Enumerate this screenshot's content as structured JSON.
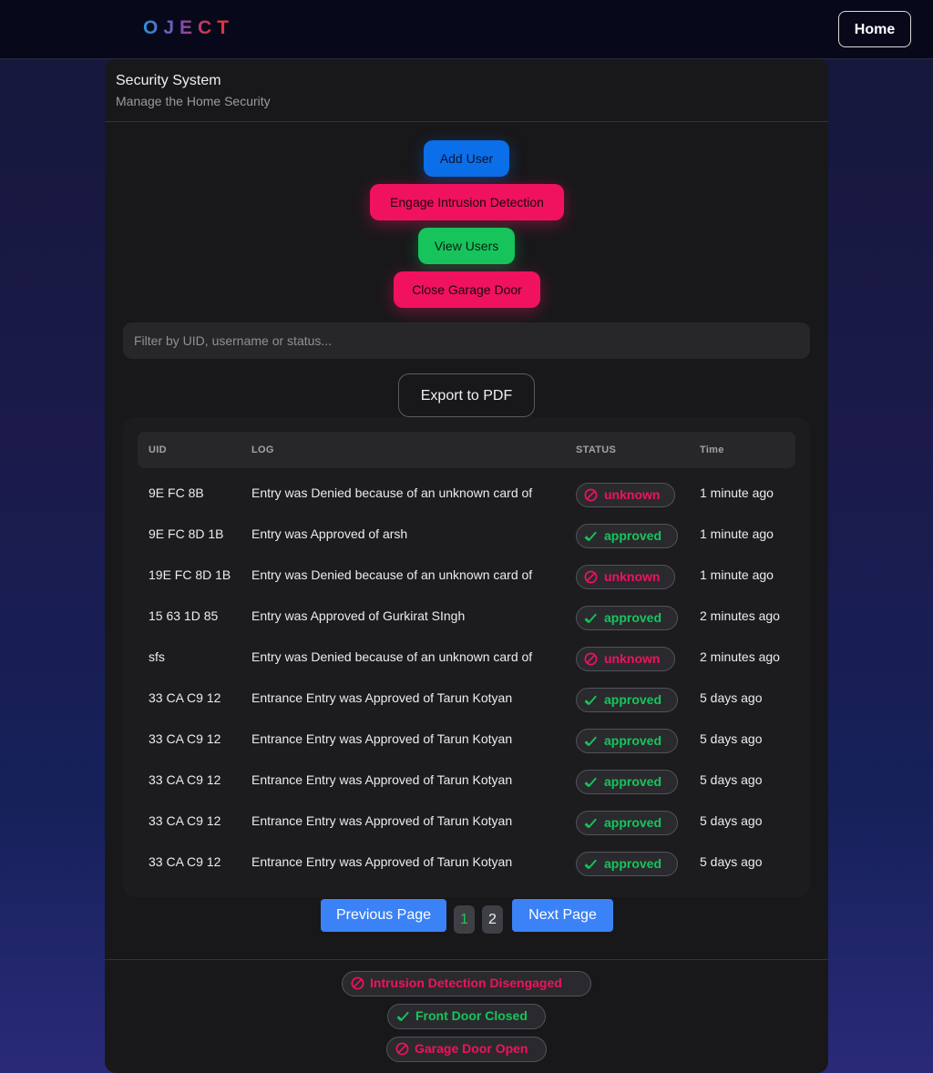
{
  "nav": {
    "brand": "OJECT",
    "home_label": "Home"
  },
  "card": {
    "title": "Security System",
    "subtitle": "Manage the Home Security"
  },
  "actions": {
    "add_user": "Add User",
    "engage_intrusion": "Engage Intrusion Detection",
    "view_users": "View Users",
    "close_garage": "Close Garage Door"
  },
  "filter": {
    "placeholder": "Filter by UID, username or status..."
  },
  "export_label": "Export to PDF",
  "table": {
    "headers": [
      "UID",
      "LOG",
      "STATUS",
      "Time"
    ],
    "rows": [
      {
        "uid": "9E FC 8B",
        "log": "Entry was Denied because of an unknown card of",
        "status": "unknown",
        "time": "1 minute ago"
      },
      {
        "uid": "9E FC 8D 1B",
        "log": "Entry was Approved of arsh",
        "status": "approved",
        "time": "1 minute ago"
      },
      {
        "uid": "19E FC 8D 1B",
        "log": "Entry was Denied because of an unknown card of",
        "status": "unknown",
        "time": "1 minute ago"
      },
      {
        "uid": "15 63 1D 85",
        "log": "Entry was Approved of Gurkirat SIngh",
        "status": "approved",
        "time": "2 minutes ago"
      },
      {
        "uid": "sfs",
        "log": "Entry was Denied because of an unknown card of",
        "status": "unknown",
        "time": "2 minutes ago"
      },
      {
        "uid": "33 CA C9 12",
        "log": "Entrance Entry was Approved of Tarun Kotyan",
        "status": "approved",
        "time": "5 days ago"
      },
      {
        "uid": "33 CA C9 12",
        "log": "Entrance Entry was Approved of Tarun Kotyan",
        "status": "approved",
        "time": "5 days ago"
      },
      {
        "uid": "33 CA C9 12",
        "log": "Entrance Entry was Approved of Tarun Kotyan",
        "status": "approved",
        "time": "5 days ago"
      },
      {
        "uid": "33 CA C9 12",
        "log": "Entrance Entry was Approved of Tarun Kotyan",
        "status": "approved",
        "time": "5 days ago"
      },
      {
        "uid": "33 CA C9 12",
        "log": "Entrance Entry was Approved of Tarun Kotyan",
        "status": "approved",
        "time": "5 days ago"
      }
    ]
  },
  "pagination": {
    "prev_label": "Previous Page",
    "next_label": "Next Page",
    "pages": [
      "1",
      "2"
    ],
    "current_page": "1"
  },
  "status": {
    "intrusion": "Intrusion Detection Disengaged",
    "front_door": "Front Door Closed",
    "garage_door": "Garage Door Open"
  },
  "colors": {
    "accent_blue": "#0a6fe8",
    "danger_pink": "#f0125e",
    "success_green": "#17c45c"
  }
}
